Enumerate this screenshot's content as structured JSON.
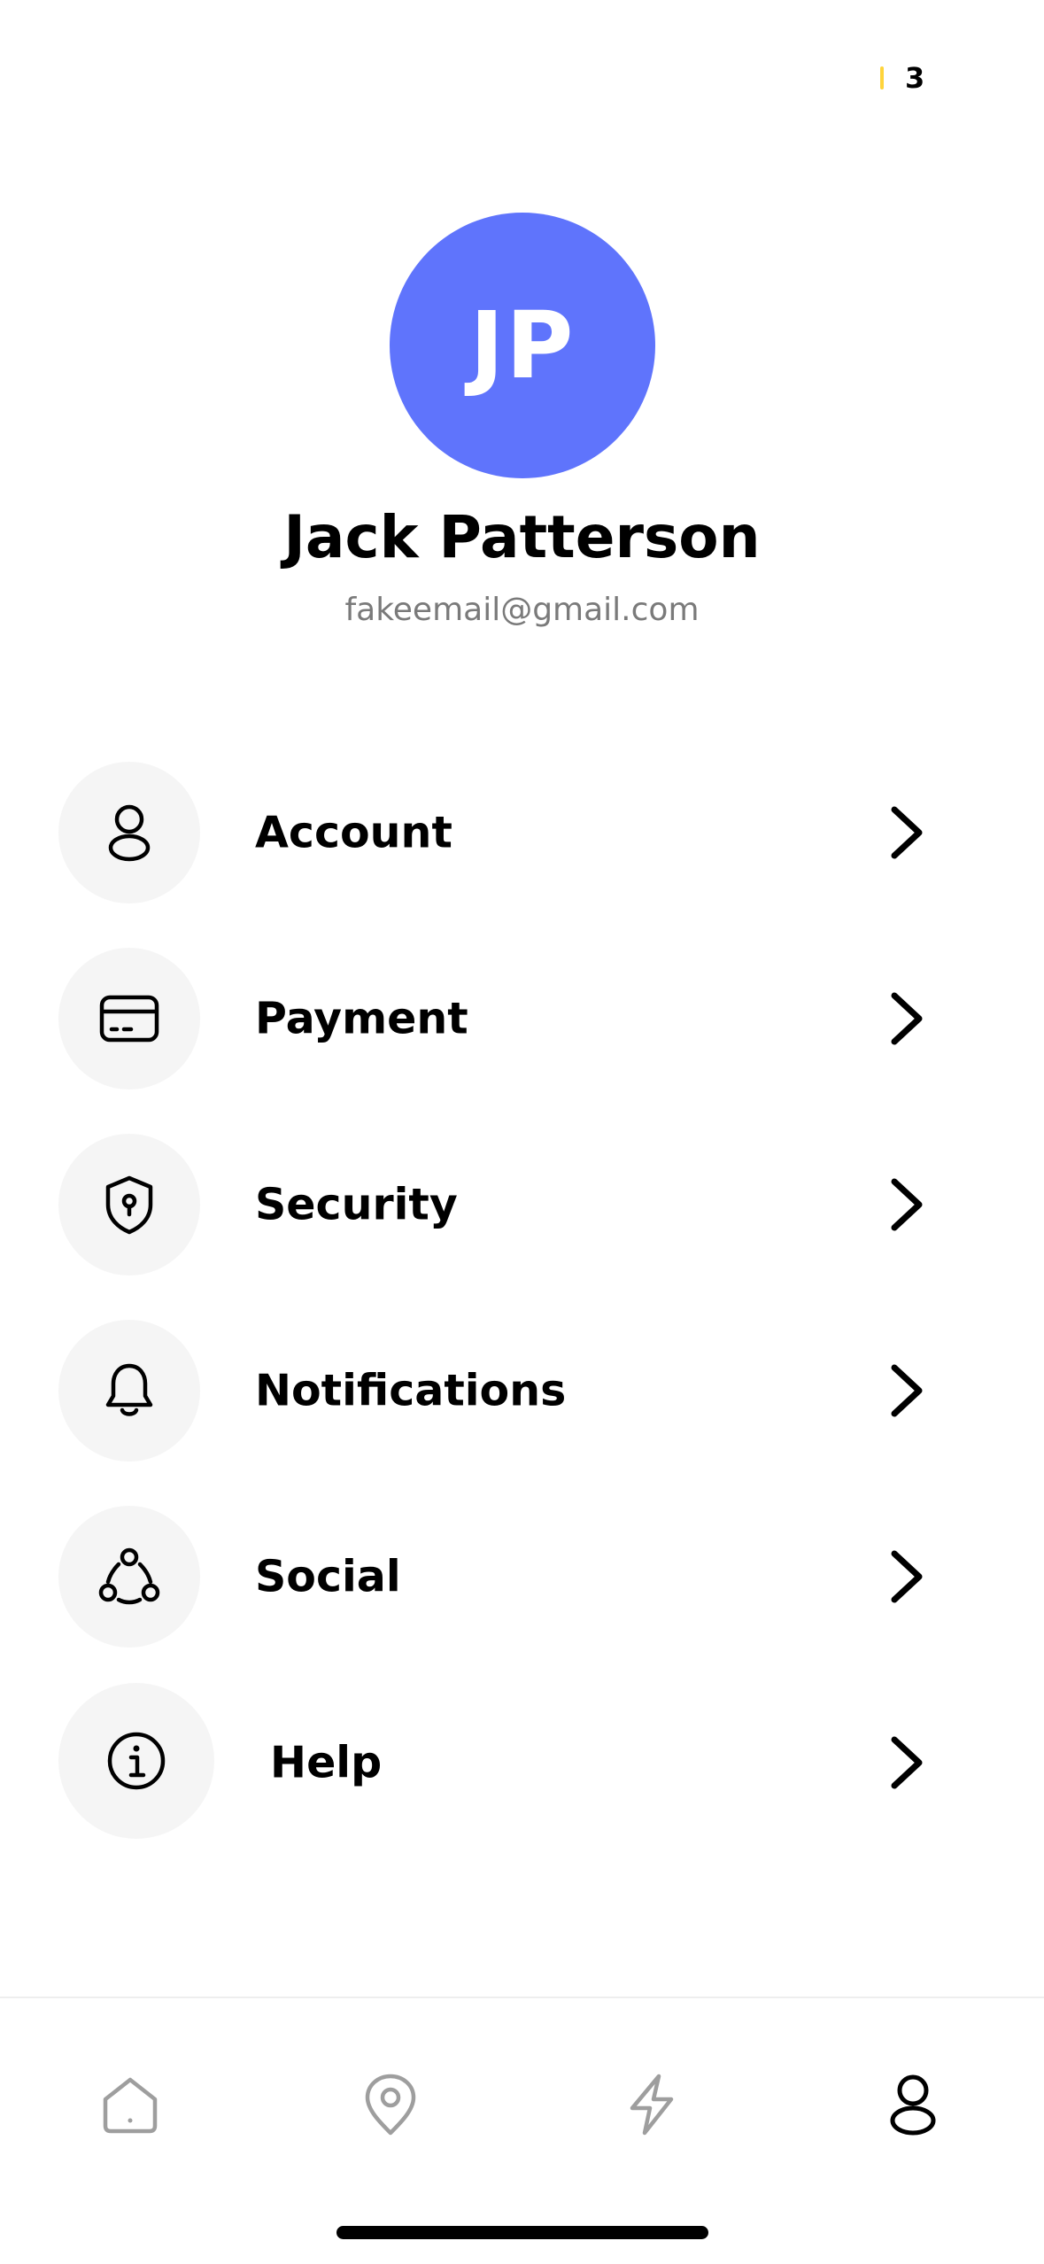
{
  "status": {
    "badge_count": "3",
    "accent_color": "#ffd43b"
  },
  "profile": {
    "initials": "JP",
    "name": "Jack Patterson",
    "email": "fakeemail@gmail.com",
    "avatar_color": "#5f74fc"
  },
  "menu": [
    {
      "label": "Account",
      "icon": "user-icon"
    },
    {
      "label": "Payment",
      "icon": "credit-card-icon"
    },
    {
      "label": "Security",
      "icon": "shield-lock-icon"
    },
    {
      "label": "Notifications",
      "icon": "bell-icon"
    },
    {
      "label": "Social",
      "icon": "social-network-icon"
    },
    {
      "label": " Help",
      "icon": "info-icon"
    }
  ],
  "bottom_nav": [
    {
      "name": "home",
      "icon": "home-icon",
      "active": false
    },
    {
      "name": "location",
      "icon": "map-pin-icon",
      "active": false
    },
    {
      "name": "activity",
      "icon": "lightning-icon",
      "active": false
    },
    {
      "name": "profile",
      "icon": "user-icon",
      "active": true
    }
  ],
  "colors": {
    "inactive_icon": "#9e9e9e",
    "active_icon": "#000000",
    "icon_circle_bg": "#f5f5f5"
  }
}
